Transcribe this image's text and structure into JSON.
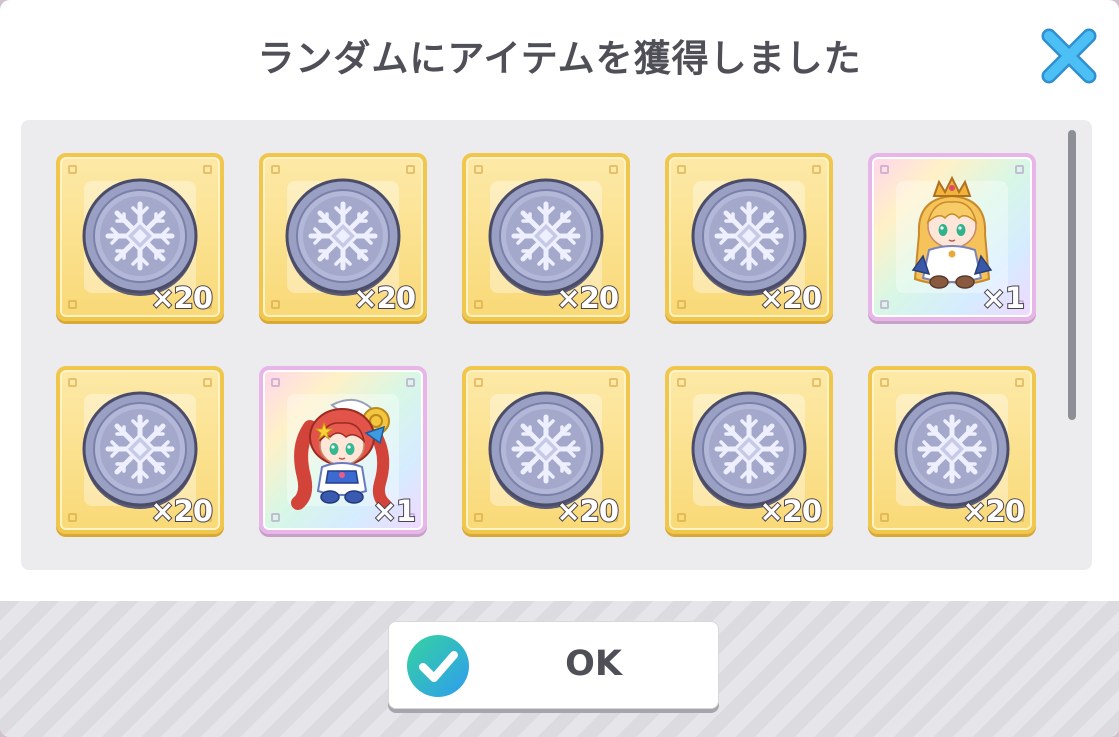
{
  "dialog": {
    "title": "ランダムにアイテムを獲得しました",
    "close_icon": "close-x-icon",
    "ok_label": "OK",
    "ok_icon": "check-circle-icon",
    "colors": {
      "accent": "#3db0f0",
      "title_text": "#4f4f57",
      "gold_frame": "#f1c64d"
    }
  },
  "items": [
    {
      "kind": "coin",
      "frame": "gold",
      "quantity": "×20",
      "icon": "silver-snowflake-coin-icon"
    },
    {
      "kind": "coin",
      "frame": "gold",
      "quantity": "×20",
      "icon": "silver-snowflake-coin-icon"
    },
    {
      "kind": "coin",
      "frame": "gold",
      "quantity": "×20",
      "icon": "silver-snowflake-coin-icon"
    },
    {
      "kind": "coin",
      "frame": "gold",
      "quantity": "×20",
      "icon": "silver-snowflake-coin-icon"
    },
    {
      "kind": "character",
      "frame": "rainbow",
      "quantity": "×1",
      "icon": "blonde-princess-chibi-icon"
    },
    {
      "kind": "coin",
      "frame": "gold",
      "quantity": "×20",
      "icon": "silver-snowflake-coin-icon"
    },
    {
      "kind": "character",
      "frame": "rainbow",
      "quantity": "×1",
      "icon": "redhead-girl-chibi-icon"
    },
    {
      "kind": "coin",
      "frame": "gold",
      "quantity": "×20",
      "icon": "silver-snowflake-coin-icon"
    },
    {
      "kind": "coin",
      "frame": "gold",
      "quantity": "×20",
      "icon": "silver-snowflake-coin-icon"
    },
    {
      "kind": "coin",
      "frame": "gold",
      "quantity": "×20",
      "icon": "silver-snowflake-coin-icon"
    }
  ]
}
